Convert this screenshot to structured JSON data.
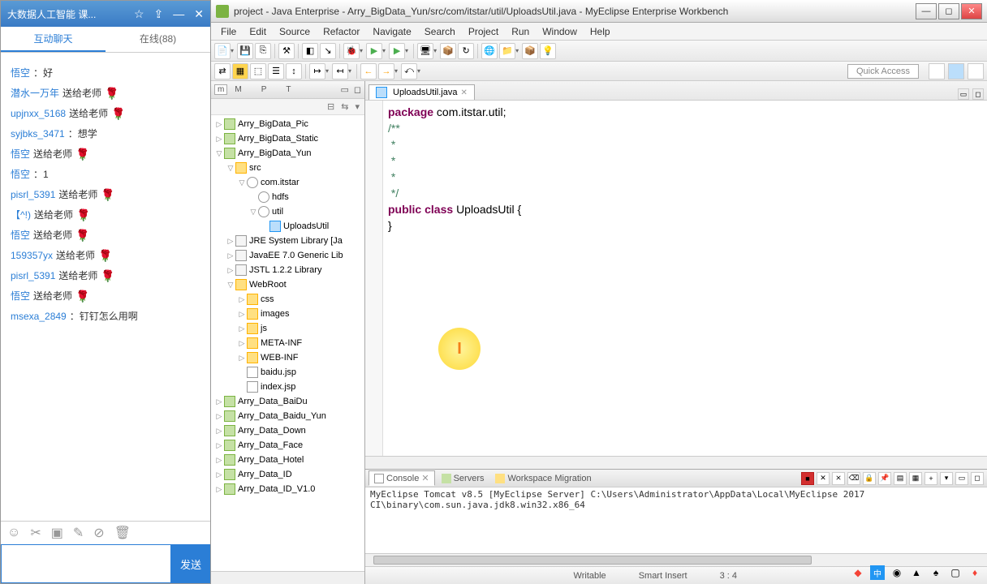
{
  "chat": {
    "title": "大数据人工智能 课...",
    "tab_active": "互动聊天",
    "tab_other": "在线(88)",
    "messages": [
      {
        "user": "悟空",
        "text": "：好",
        "flower": false
      },
      {
        "user": "潜水一万年",
        "text": " 送给老师",
        "flower": true
      },
      {
        "user": "upjnxx_5168",
        "text": " 送给老师",
        "flower": true
      },
      {
        "user": "syjbks_3471",
        "text": "：想学",
        "flower": false
      },
      {
        "user": "悟空",
        "text": " 送给老师",
        "flower": true
      },
      {
        "user": "悟空",
        "text": "：1",
        "flower": false
      },
      {
        "user": "pisrl_5391",
        "text": " 送给老师",
        "flower": true
      },
      {
        "user": "【^!)",
        "text": " 送给老师",
        "flower": true
      },
      {
        "user": "悟空",
        "text": " 送给老师",
        "flower": true
      },
      {
        "user": "159357yx",
        "text": " 送给老师",
        "flower": true
      },
      {
        "user": "pisrl_5391",
        "text": " 送给老师",
        "flower": true
      },
      {
        "user": "悟空",
        "text": " 送给老师",
        "flower": true
      },
      {
        "user": "msexa_2849",
        "text": "：钉钉怎么用啊",
        "flower": false
      }
    ],
    "send_label": "发送"
  },
  "ide": {
    "title": "project - Java Enterprise - Arry_BigData_Yun/src/com/itstar/util/UploadsUtil.java - MyEclipse Enterprise Workbench",
    "menu": [
      "File",
      "Edit",
      "Source",
      "Refactor",
      "Navigate",
      "Search",
      "Project",
      "Run",
      "Window",
      "Help"
    ],
    "quick_access": "Quick Access",
    "explorer_tabs": [
      "m",
      "M",
      "",
      "P",
      "",
      "T"
    ],
    "tree": [
      {
        "d": 0,
        "a": "▷",
        "i": "proj",
        "l": "Arry_BigData_Pic"
      },
      {
        "d": 0,
        "a": "▷",
        "i": "proj",
        "l": "Arry_BigData_Static"
      },
      {
        "d": 0,
        "a": "▽",
        "i": "proj",
        "l": "Arry_BigData_Yun"
      },
      {
        "d": 1,
        "a": "▽",
        "i": "folder",
        "l": "src"
      },
      {
        "d": 2,
        "a": "▽",
        "i": "pkg",
        "l": "com.itstar"
      },
      {
        "d": 3,
        "a": "",
        "i": "pkg",
        "l": "hdfs"
      },
      {
        "d": 3,
        "a": "▽",
        "i": "pkg",
        "l": "util"
      },
      {
        "d": 4,
        "a": "",
        "i": "java",
        "l": "UploadsUtil"
      },
      {
        "d": 1,
        "a": "▷",
        "i": "lib",
        "l": "JRE System Library [Ja"
      },
      {
        "d": 1,
        "a": "▷",
        "i": "lib",
        "l": "JavaEE 7.0 Generic Lib"
      },
      {
        "d": 1,
        "a": "▷",
        "i": "lib",
        "l": "JSTL 1.2.2 Library"
      },
      {
        "d": 1,
        "a": "▽",
        "i": "folder",
        "l": "WebRoot"
      },
      {
        "d": 2,
        "a": "▷",
        "i": "folder",
        "l": "css"
      },
      {
        "d": 2,
        "a": "▷",
        "i": "folder",
        "l": "images"
      },
      {
        "d": 2,
        "a": "▷",
        "i": "folder",
        "l": "js"
      },
      {
        "d": 2,
        "a": "▷",
        "i": "folder",
        "l": "META-INF"
      },
      {
        "d": 2,
        "a": "▷",
        "i": "folder",
        "l": "WEB-INF"
      },
      {
        "d": 2,
        "a": "",
        "i": "file",
        "l": "baidu.jsp"
      },
      {
        "d": 2,
        "a": "",
        "i": "file",
        "l": "index.jsp"
      },
      {
        "d": 0,
        "a": "▷",
        "i": "proj",
        "l": "Arry_Data_BaiDu"
      },
      {
        "d": 0,
        "a": "▷",
        "i": "proj",
        "l": "Arry_Data_Baidu_Yun"
      },
      {
        "d": 0,
        "a": "▷",
        "i": "proj",
        "l": "Arry_Data_Down"
      },
      {
        "d": 0,
        "a": "▷",
        "i": "proj",
        "l": "Arry_Data_Face"
      },
      {
        "d": 0,
        "a": "▷",
        "i": "proj",
        "l": "Arry_Data_Hotel"
      },
      {
        "d": 0,
        "a": "▷",
        "i": "proj",
        "l": "Arry_Data_ID"
      },
      {
        "d": 0,
        "a": "▷",
        "i": "proj",
        "l": "Arry_Data_ID_V1.0"
      }
    ],
    "editor_tab": "UploadsUtil.java",
    "code": {
      "l1_kw": "package",
      "l1_rest": " com.itstar.util;",
      "l2": "/**",
      "l3": " *",
      "l4": " *",
      "l5": " *",
      "l6": " */",
      "l7_kw1": "public",
      "l7_kw2": "class",
      "l7_name": "UploadsUtil",
      "l7_brace": " {",
      "l8": "",
      "l9": "",
      "l10": "",
      "l11": "}"
    },
    "console": {
      "tab_console": "Console",
      "tab_servers": "Servers",
      "tab_wm": "Workspace Migration",
      "output": "MyEclipse Tomcat v8.5 [MyEclipse Server] C:\\Users\\Administrator\\AppData\\Local\\MyEclipse 2017 CI\\binary\\com.sun.java.jdk8.win32.x86_64"
    },
    "status": {
      "writable": "Writable",
      "insert": "Smart Insert",
      "pos": "3 : 4"
    }
  }
}
